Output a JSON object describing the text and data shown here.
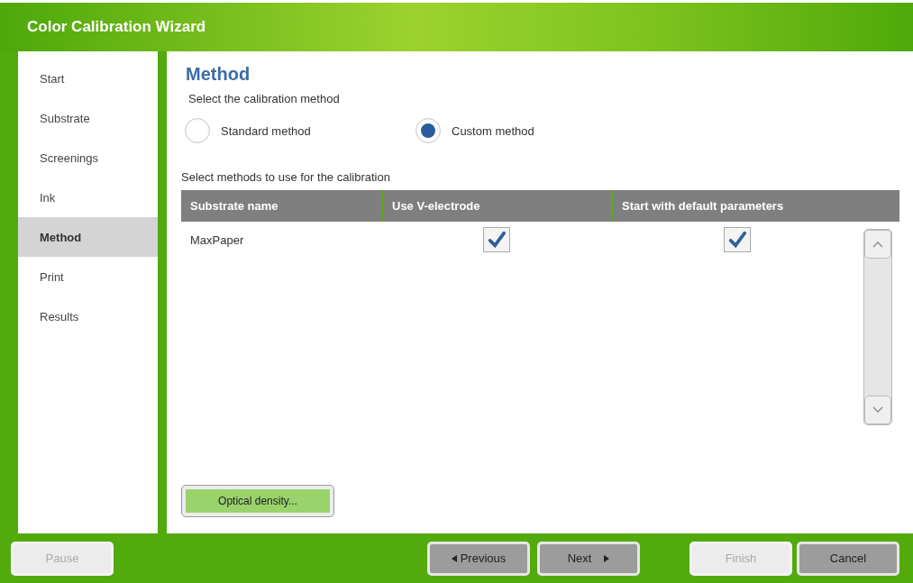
{
  "window": {
    "title": "Color Calibration Wizard"
  },
  "sidebar": {
    "items": [
      {
        "label": "Start",
        "selected": false
      },
      {
        "label": "Substrate",
        "selected": false
      },
      {
        "label": "Screenings",
        "selected": false
      },
      {
        "label": "Ink",
        "selected": false
      },
      {
        "label": "Method",
        "selected": true
      },
      {
        "label": "Print",
        "selected": false
      },
      {
        "label": "Results",
        "selected": false
      }
    ]
  },
  "page": {
    "heading": "Method",
    "prompt": "Select the calibration method",
    "methods": [
      {
        "label": "Standard method",
        "selected": false
      },
      {
        "label": "Custom method",
        "selected": true
      }
    ],
    "table_prompt": "Select methods to use for the calibration",
    "table": {
      "columns": [
        "Substrate name",
        "Use V-electrode",
        "Start with default parameters"
      ],
      "rows": [
        {
          "name": "MaxPaper",
          "use_v_electrode": true,
          "default_parameters": true
        }
      ]
    },
    "optical_button": "Optical density..."
  },
  "footer": {
    "buttons": [
      {
        "label": "Pause",
        "kind": "plain",
        "disabled": true
      },
      {
        "label": "Previous",
        "kind": "back",
        "disabled": false
      },
      {
        "label": "Next",
        "kind": "forward",
        "disabled": false
      },
      {
        "label": "Finish",
        "kind": "plain",
        "disabled": true
      },
      {
        "label": "Cancel",
        "kind": "plain",
        "disabled": false
      }
    ]
  }
}
